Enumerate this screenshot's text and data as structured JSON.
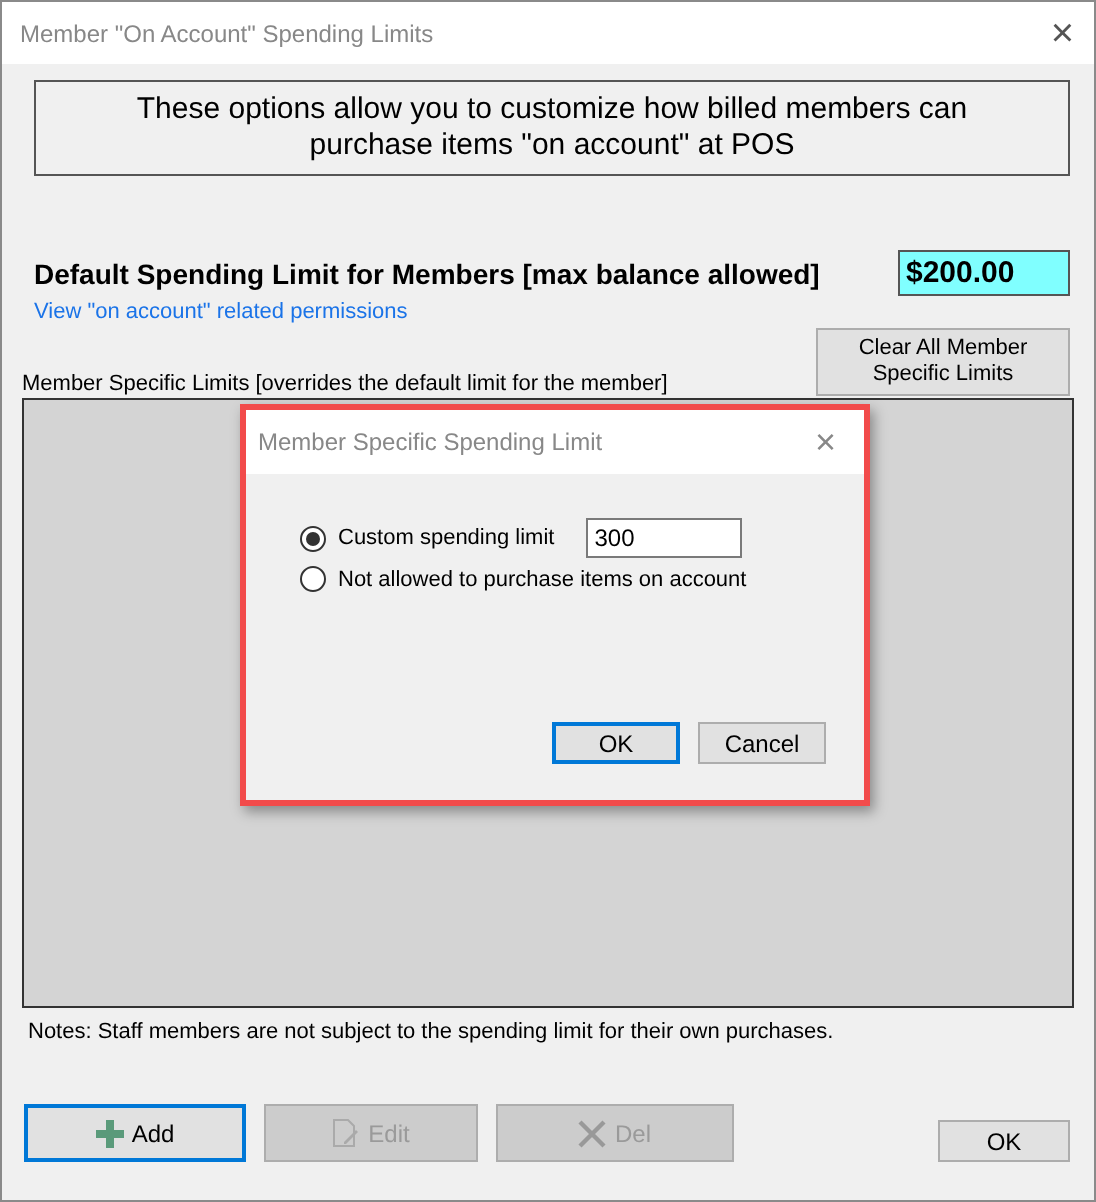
{
  "window": {
    "title": "Member \"On Account\" Spending Limits",
    "close": "×"
  },
  "intro": "These options allow you to customize how billed members can purchase items \"on account\" at POS",
  "default_limit": {
    "label": "Default Spending Limit for Members [max balance allowed]",
    "value": "$200.00"
  },
  "permissions_link": "View \"on account\" related permissions",
  "clear_button": "Clear All Member Specific Limits",
  "list_label": "Member Specific Limits [overrides the default limit for the member]",
  "notes": "Notes:  Staff members are not subject to the spending limit for their own purchases.",
  "buttons": [
    {
      "kind": "add",
      "label": "Add",
      "disabled": false,
      "focused": true
    },
    {
      "kind": "edit",
      "label": "Edit",
      "disabled": true,
      "focused": false
    },
    {
      "kind": "delete",
      "label": "Del",
      "disabled": true,
      "focused": false
    }
  ],
  "ok_button": "OK",
  "dialog": {
    "title": "Member Specific Spending Limit",
    "close": "×",
    "options": [
      {
        "label": "Custom spending limit",
        "selected": true,
        "value": "300"
      },
      {
        "label": "Not allowed to purchase items on account",
        "selected": false
      }
    ],
    "ok": "OK",
    "cancel": "Cancel"
  }
}
